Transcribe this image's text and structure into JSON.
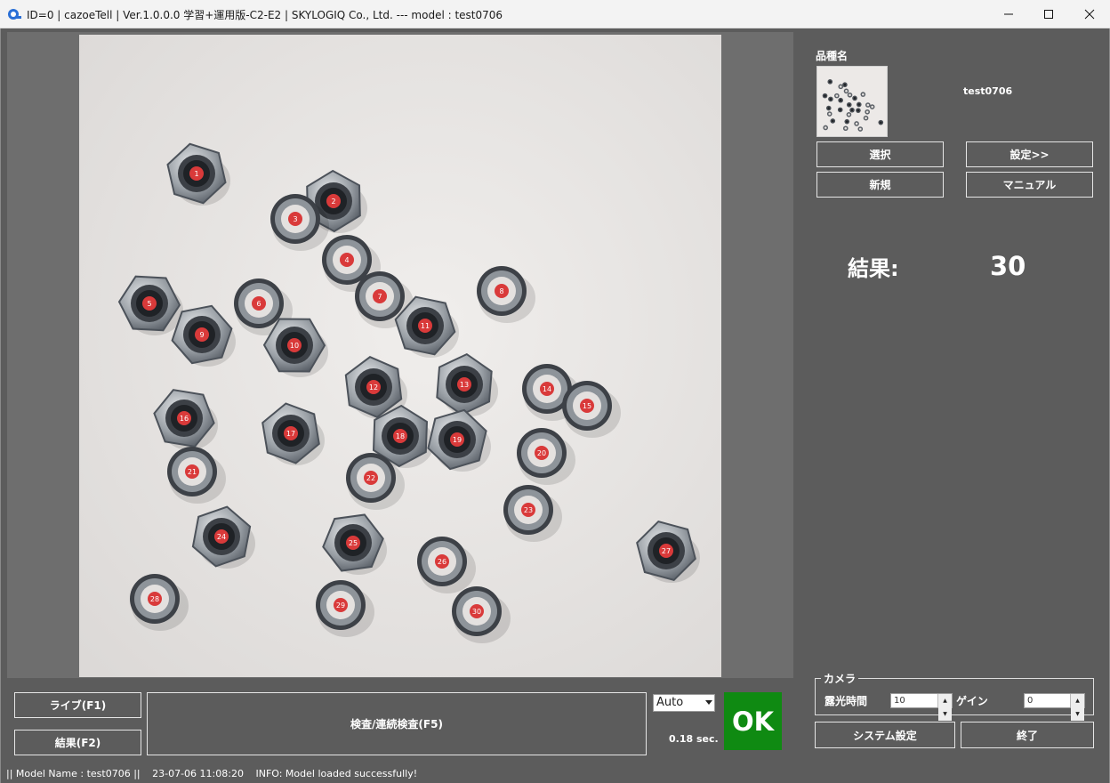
{
  "window": {
    "title": "ID=0 | cazoeTell | Ver.1.0.0.0 学習+運用版-C2-E2 | SKYLOGIQ Co., Ltd. --- model : test0706"
  },
  "model": {
    "label": "品種名",
    "name": "test0706"
  },
  "buttons": {
    "select": "選択",
    "settings": "設定>>",
    "new": "新規",
    "manual": "マニュアル",
    "live": "ライブ(F1)",
    "result": "結果(F2)",
    "inspect": "検査/連続検査(F5)",
    "system_settings": "システム設定",
    "exit": "終了"
  },
  "result": {
    "label": "結果:",
    "count": "30",
    "status": "OK",
    "status_color": "#0f8a12",
    "time": "0.18 sec."
  },
  "mode_select": {
    "value": "Auto"
  },
  "camera": {
    "legend": "カメラ",
    "exposure_label": "露光時間",
    "exposure_value": "10",
    "gain_label": "ゲイン",
    "gain_value": "0"
  },
  "statusbar": {
    "model": "|| Model Name : test0706 ||",
    "timestamp": "23-07-06 11:08:20",
    "message": "INFO:   Model loaded successfully!"
  },
  "detections": {
    "marker_color": "#d93a3a",
    "items": [
      {
        "n": "1",
        "kind": "nut"
      },
      {
        "n": "2",
        "kind": "nut"
      },
      {
        "n": "3",
        "kind": "washer"
      },
      {
        "n": "4",
        "kind": "washer"
      },
      {
        "n": "5",
        "kind": "nut"
      },
      {
        "n": "6",
        "kind": "washer"
      },
      {
        "n": "7",
        "kind": "washer"
      },
      {
        "n": "8",
        "kind": "washer"
      },
      {
        "n": "9",
        "kind": "nut"
      },
      {
        "n": "10",
        "kind": "nut"
      },
      {
        "n": "11",
        "kind": "nut"
      },
      {
        "n": "12",
        "kind": "nut"
      },
      {
        "n": "13",
        "kind": "nut"
      },
      {
        "n": "14",
        "kind": "washer"
      },
      {
        "n": "15",
        "kind": "washer"
      },
      {
        "n": "16",
        "kind": "nut"
      },
      {
        "n": "17",
        "kind": "nut"
      },
      {
        "n": "18",
        "kind": "nut"
      },
      {
        "n": "19",
        "kind": "nut"
      },
      {
        "n": "20",
        "kind": "washer"
      },
      {
        "n": "21",
        "kind": "washer"
      },
      {
        "n": "22",
        "kind": "washer"
      },
      {
        "n": "23",
        "kind": "washer"
      },
      {
        "n": "24",
        "kind": "nut"
      },
      {
        "n": "25",
        "kind": "nut"
      },
      {
        "n": "26",
        "kind": "washer"
      },
      {
        "n": "27",
        "kind": "nut"
      },
      {
        "n": "28",
        "kind": "washer"
      },
      {
        "n": "29",
        "kind": "washer"
      },
      {
        "n": "30",
        "kind": "washer"
      }
    ]
  }
}
